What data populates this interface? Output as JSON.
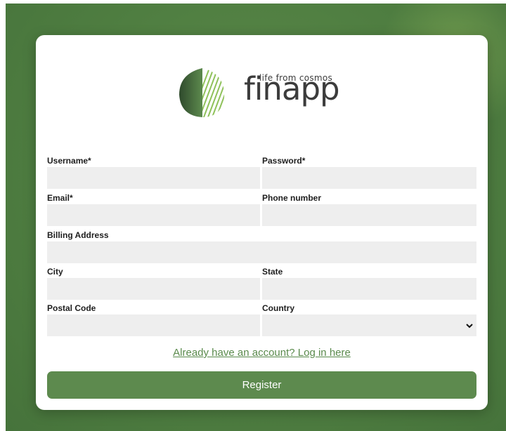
{
  "brand": {
    "wordmark": "finapp",
    "tagline": "life from cosmos",
    "logo_icon": "finapp-leaf-logo-icon",
    "colors": {
      "dark_green": "#3e5f36",
      "mid_green": "#5d8a4e",
      "light_green": "#8fc15a"
    }
  },
  "form": {
    "username": {
      "label": "Username",
      "required_mark": "*",
      "value": ""
    },
    "password": {
      "label": "Password",
      "required_mark": "*",
      "value": ""
    },
    "email": {
      "label": "Email",
      "required_mark": "*",
      "value": ""
    },
    "phone": {
      "label": "Phone number",
      "value": ""
    },
    "billing_address": {
      "label": "Billing Address",
      "value": ""
    },
    "city": {
      "label": "City",
      "value": ""
    },
    "state": {
      "label": "State",
      "value": ""
    },
    "postal_code": {
      "label": "Postal Code",
      "value": ""
    },
    "country": {
      "label": "Country",
      "selected": ""
    }
  },
  "login_link": "Already have an account? Log in here",
  "register_label": "Register",
  "colors": {
    "accent": "#5d8a4e",
    "link": "#5a8a4c",
    "input_bg": "#eeeeee"
  }
}
